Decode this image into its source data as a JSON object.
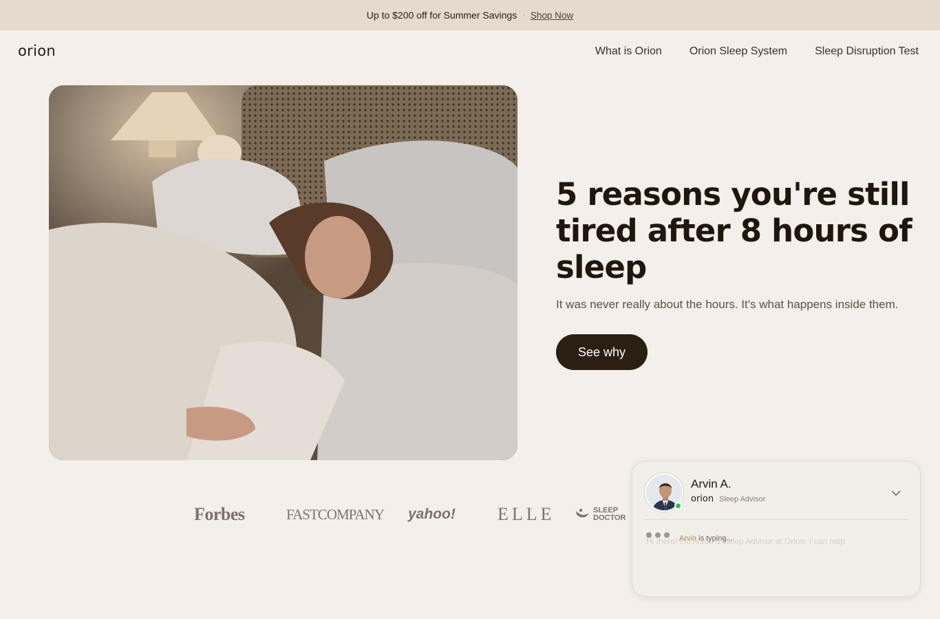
{
  "promo": {
    "text": "Up to $200 off for Summer Savings",
    "separator": "·",
    "link": "Shop Now"
  },
  "header": {
    "logo": "orion",
    "nav": [
      "What is Orion",
      "Orion Sleep System",
      "Sleep Disruption Test"
    ]
  },
  "hero": {
    "title": "5 reasons you're still tired after 8 hours of sleep",
    "subtitle": "It was never really about the hours. It's what happens inside them.",
    "cta": "See why"
  },
  "press": [
    "Forbes",
    "FASTCOMPANY",
    "yahoo!",
    "ELLE",
    "SLEEP",
    "DOCTOR"
  ],
  "chat": {
    "name": "Arvin A.",
    "brand": "orion",
    "role": "Sleep Advisor",
    "message": "Hi there! I'm Arvin, a Sleep Advisor at Orion. I can help",
    "typing_name": "Arvin",
    "typing_suffix": " is typing...",
    "status": "online"
  },
  "colors": {
    "background": "#f4efea",
    "promo_bar": "#e4dacd",
    "cta": "#2a1f12",
    "online": "#2fbf4b"
  },
  "icons": [
    "chevron-down-icon",
    "sleep-doctor-icon"
  ]
}
